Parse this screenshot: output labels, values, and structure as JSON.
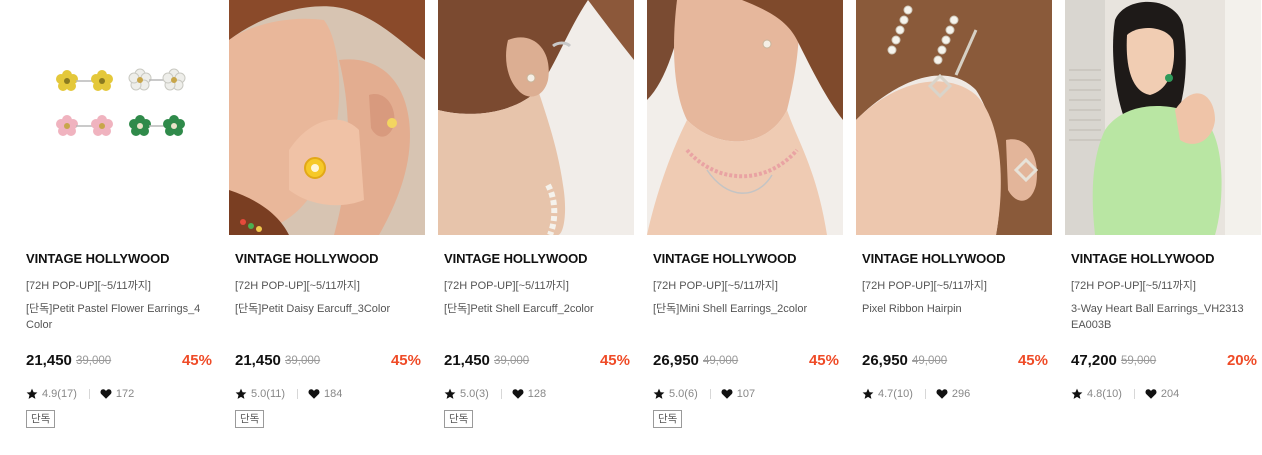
{
  "products": [
    {
      "brand": "VINTAGE HOLLYWOOD",
      "promo": "[72H POP-UP][~5/11까지]",
      "name": "[단독]Petit Pastel Flower Earrings_4 Color",
      "price": "21,450",
      "original_price": "39,000",
      "discount": "45%",
      "rating": "4.9(17)",
      "likes": "172",
      "tag": "단독",
      "image": "flower-earrings-product-photo"
    },
    {
      "brand": "VINTAGE HOLLYWOOD",
      "promo": "[72H POP-UP][~5/11까지]",
      "name": "[단독]Petit Daisy Earcuff_3Color",
      "price": "21,450",
      "original_price": "39,000",
      "discount": "45%",
      "rating": "5.0(11)",
      "likes": "184",
      "tag": "단독",
      "image": "model-with-earcuff-photo"
    },
    {
      "brand": "VINTAGE HOLLYWOOD",
      "promo": "[72H POP-UP][~5/11까지]",
      "name": "[단독]Petit Shell Earcuff_2color",
      "price": "21,450",
      "original_price": "39,000",
      "discount": "45%",
      "rating": "5.0(3)",
      "likes": "128",
      "tag": "단독",
      "image": "model-ear-closeup-photo"
    },
    {
      "brand": "VINTAGE HOLLYWOOD",
      "promo": "[72H POP-UP][~5/11까지]",
      "name": "[단독]Mini Shell Earrings_2color",
      "price": "26,950",
      "original_price": "49,000",
      "discount": "45%",
      "rating": "5.0(6)",
      "likes": "107",
      "tag": "단독",
      "image": "model-with-necklace-photo"
    },
    {
      "brand": "VINTAGE HOLLYWOOD",
      "promo": "[72H POP-UP][~5/11까지]",
      "name": "Pixel Ribbon Hairpin",
      "price": "26,950",
      "original_price": "49,000",
      "discount": "45%",
      "rating": "4.7(10)",
      "likes": "296",
      "tag": "",
      "image": "model-with-pearl-hairpins-photo"
    },
    {
      "brand": "VINTAGE HOLLYWOOD",
      "promo": "[72H POP-UP][~5/11까지]",
      "name": "3-Way Heart Ball Earrings_VH2313 EA003B",
      "price": "47,200",
      "original_price": "59,000",
      "discount": "20%",
      "rating": "4.8(10)",
      "likes": "204",
      "tag": "",
      "image": "model-in-green-knit-photo"
    }
  ],
  "colors": {
    "discount": "#ef4b27",
    "text": "#111111",
    "muted": "#888888"
  }
}
